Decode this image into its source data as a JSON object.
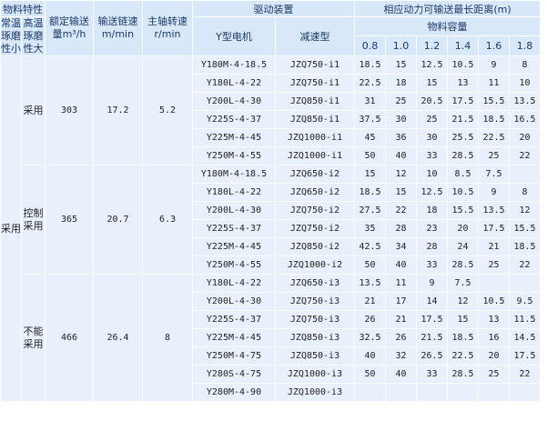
{
  "headers": {
    "material_property": "物料特性",
    "normal_temp": "常温琢磨性小",
    "high_temp": "高温琢磨性大",
    "rated_capacity": "额定输送量m³/h",
    "chain_speed": "输送链速m/min",
    "shaft_speed": "主轴转速r/min",
    "drive_unit": "驱动装置",
    "motor": "Y型电机",
    "reducer": "减速型",
    "max_distance": "相应动力可输送最长距离(m)",
    "material_capacity": "物料容量",
    "capacities": [
      "0.8",
      "1.0",
      "1.2",
      "1.4",
      "1.6",
      "1.8"
    ]
  },
  "groups": [
    {
      "normal_temp": "采用",
      "high_temp": "采用",
      "capacity": "303",
      "chain_speed": "17.2",
      "shaft_speed": "5.2",
      "rows": [
        {
          "motor": "Y180M-4-18.5",
          "reducer": "JZQ750-i1",
          "d": [
            "18.5",
            "15",
            "12.5",
            "10.5",
            "9",
            "8"
          ]
        },
        {
          "motor": "Y180L-4-22",
          "reducer": "JZQ750-i1",
          "d": [
            "22.5",
            "18",
            "15",
            "13",
            "11",
            "10"
          ]
        },
        {
          "motor": "Y200L-4-30",
          "reducer": "JZQ850-i1",
          "d": [
            "31",
            "25",
            "20.5",
            "17.5",
            "15.5",
            "13.5"
          ]
        },
        {
          "motor": "Y225S-4-37",
          "reducer": "JZQ850-i1",
          "d": [
            "37.5",
            "30",
            "25",
            "21.5",
            "18.5",
            "16.5"
          ]
        },
        {
          "motor": "Y225M-4-45",
          "reducer": "JZQ1000-i1",
          "d": [
            "45",
            "36",
            "30",
            "25.5",
            "22.5",
            "20"
          ]
        },
        {
          "motor": "Y250M-4-55",
          "reducer": "JZQ1000-i1",
          "d": [
            "50",
            "40",
            "33",
            "28.5",
            "25",
            "22"
          ]
        }
      ]
    },
    {
      "high_temp": "控制采用",
      "capacity": "365",
      "chain_speed": "20.7",
      "shaft_speed": "6.3",
      "rows": [
        {
          "motor": "Y180M-4-18.5",
          "reducer": "JZQ650-i2",
          "d": [
            "15",
            "12",
            "10",
            "8.5",
            "7.5",
            ""
          ]
        },
        {
          "motor": "Y180L-4-22",
          "reducer": "JZQ650-i2",
          "d": [
            "18.5",
            "15",
            "12.5",
            "10.5",
            "9",
            "8"
          ]
        },
        {
          "motor": "Y200L-4-30",
          "reducer": "JZQ750-i2",
          "d": [
            "27.5",
            "22",
            "18",
            "15.5",
            "13.5",
            "12"
          ]
        },
        {
          "motor": "Y225S-4-37",
          "reducer": "JZQ750-i2",
          "d": [
            "35",
            "28",
            "23",
            "20",
            "17.5",
            "15.5"
          ]
        },
        {
          "motor": "Y225M-4-45",
          "reducer": "JZQ850-i2",
          "d": [
            "42.5",
            "34",
            "28",
            "24",
            "21",
            "18.5"
          ]
        },
        {
          "motor": "Y250M-4-55",
          "reducer": "JZQ1000-i2",
          "d": [
            "50",
            "40",
            "33",
            "28.5",
            "25",
            "22"
          ]
        }
      ]
    },
    {
      "high_temp": "不能采用",
      "capacity": "466",
      "chain_speed": "26.4",
      "shaft_speed": "8",
      "rows": [
        {
          "motor": "Y180L-4-22",
          "reducer": "JZQ650-i3",
          "d": [
            "13.5",
            "11",
            "9",
            "7.5",
            "",
            ""
          ]
        },
        {
          "motor": "Y200L-4-30",
          "reducer": "JZQ750-i3",
          "d": [
            "21",
            "17",
            "14",
            "12",
            "10.5",
            "9.5"
          ]
        },
        {
          "motor": "Y225S-4-37",
          "reducer": "JZQ750-i3",
          "d": [
            "26",
            "21",
            "17.5",
            "15",
            "13",
            "11.5"
          ]
        },
        {
          "motor": "Y225M-4-45",
          "reducer": "JZQ850-i3",
          "d": [
            "32.5",
            "26",
            "21.5",
            "18.5",
            "16",
            "14.5"
          ]
        },
        {
          "motor": "Y250M-4-75",
          "reducer": "JZQ850-i3",
          "d": [
            "40",
            "32",
            "26.5",
            "22.5",
            "20",
            "17.5"
          ]
        },
        {
          "motor": "Y280S-4-75",
          "reducer": "JZQ1000-i3",
          "d": [
            "50",
            "40",
            "33",
            "28.5",
            "25",
            "22"
          ]
        },
        {
          "motor": "Y280M-4-90",
          "reducer": "JZQ1000-i3",
          "d": [
            "",
            "",
            "",
            "",
            "",
            ""
          ]
        }
      ]
    }
  ]
}
